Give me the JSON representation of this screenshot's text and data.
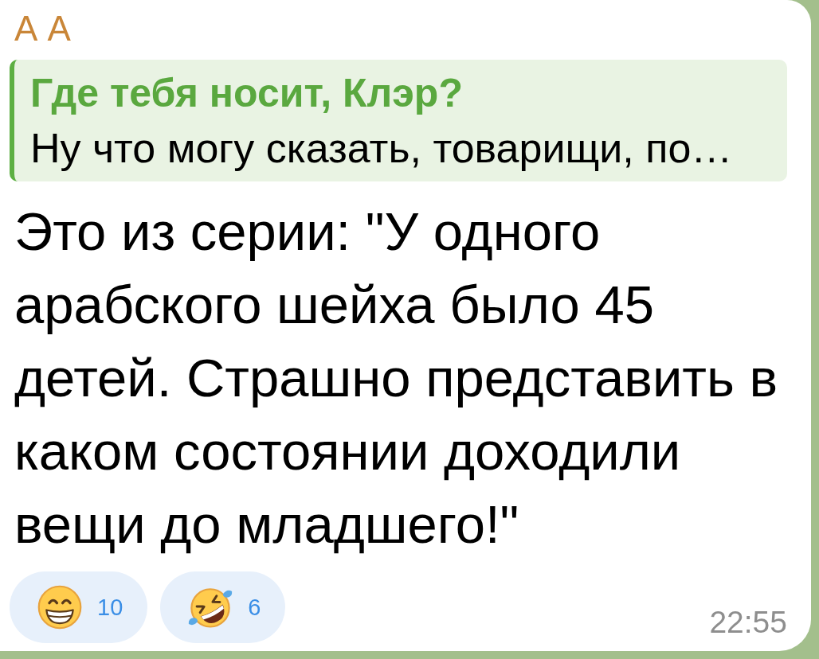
{
  "message": {
    "sender": "А А",
    "reply": {
      "title": "Где тебя носит, Клэр?",
      "text": "Ну что могу сказать, товарищи, по…"
    },
    "text": "Это из серии: \"У одного арабского шейха было 45 детей. Страшно представить в каком состоянии доходили вещи до младшего!\"",
    "reactions": [
      {
        "kind": "grin",
        "count": "10",
        "selected": false
      },
      {
        "kind": "rofl",
        "count": "6",
        "selected": false
      }
    ],
    "time": "22:55"
  }
}
